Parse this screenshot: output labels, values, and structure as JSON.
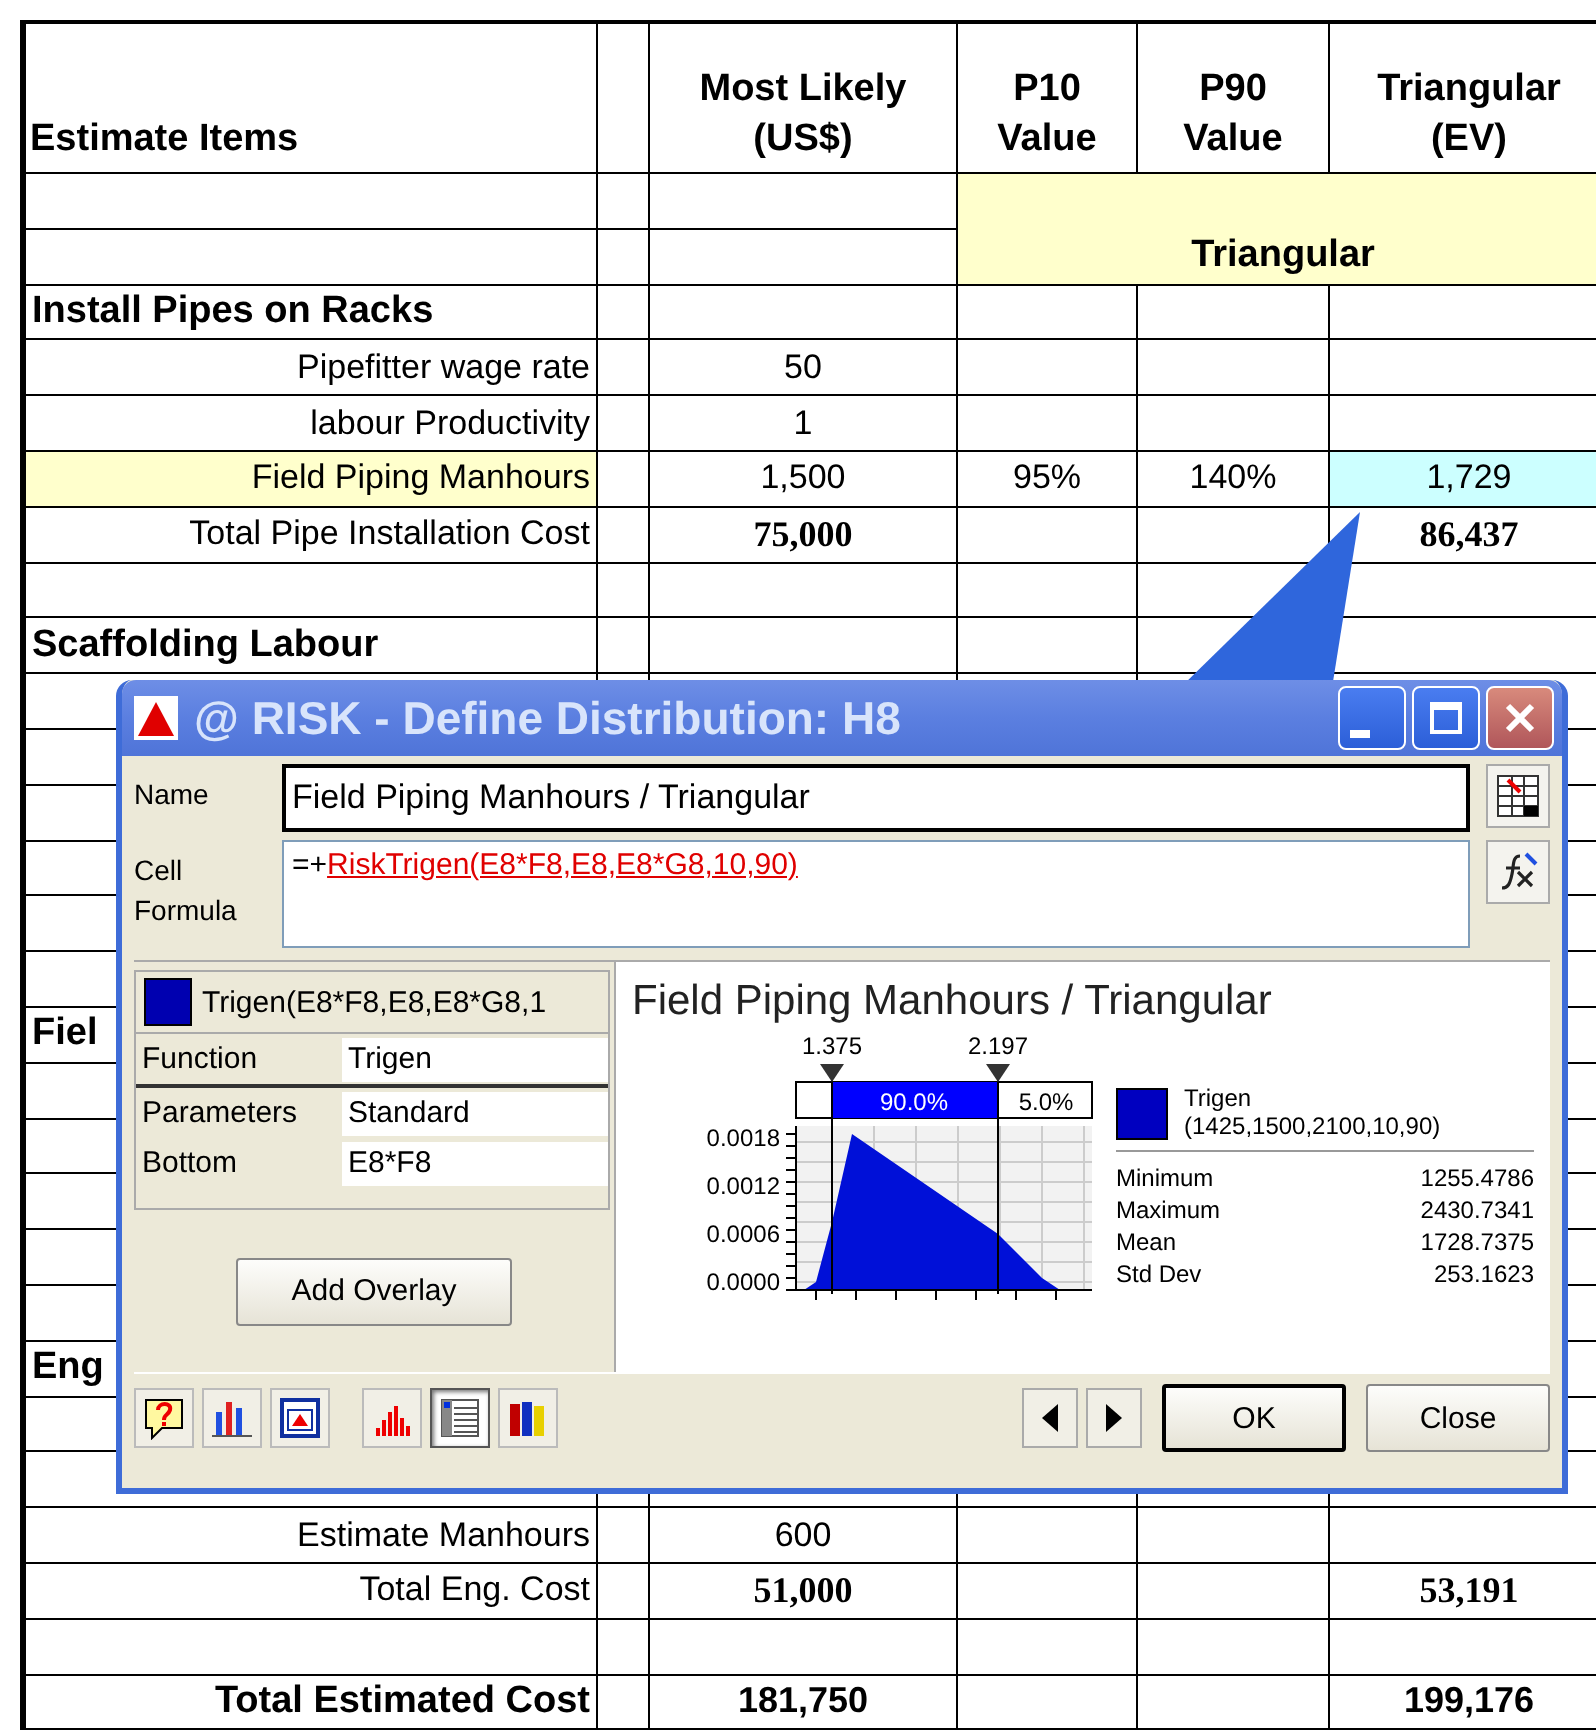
{
  "sheet": {
    "headers": [
      "Estimate Items",
      "Most Likely\n(US$)",
      "P10\nValue",
      "P90\nValue",
      "Triangular\n(EV)"
    ],
    "group_header": "Triangular",
    "rows": [
      {
        "kind": "blank",
        "active": false
      },
      {
        "kind": "blank",
        "active": false
      },
      {
        "kind": "section",
        "label": "Install Pipes on Racks",
        "active": false
      },
      {
        "kind": "item",
        "label": "Pipefitter wage rate",
        "most_likely": "50",
        "active": false
      },
      {
        "kind": "item",
        "label": "labour Productivity",
        "most_likely": "1",
        "active": false
      },
      {
        "kind": "item",
        "label": "Field Piping Manhours",
        "most_likely": "1,500",
        "p10": "95%",
        "p90": "140%",
        "triangular": "1,729",
        "active": true
      },
      {
        "kind": "total",
        "label": "Total Pipe Installation Cost",
        "most_likely": "75,000",
        "triangular": "86,437",
        "active": false
      },
      {
        "kind": "blank",
        "active": false
      },
      {
        "kind": "section",
        "label": "Scaffolding Labour",
        "active": false
      },
      {
        "kind": "blank",
        "active": false
      },
      {
        "kind": "blank",
        "active": false
      },
      {
        "kind": "blank",
        "active": false
      },
      {
        "kind": "blank",
        "active": false
      },
      {
        "kind": "blank",
        "active": false
      },
      {
        "kind": "blank",
        "active": false
      },
      {
        "kind": "section",
        "label": "Fiel",
        "active": false
      },
      {
        "kind": "blank",
        "active": false
      },
      {
        "kind": "blank",
        "active": false
      },
      {
        "kind": "blank",
        "active": false
      },
      {
        "kind": "blank",
        "active": false
      },
      {
        "kind": "blank",
        "active": false
      },
      {
        "kind": "section",
        "label": "Eng",
        "active": false
      },
      {
        "kind": "blank",
        "active": false
      },
      {
        "kind": "blank",
        "active": false
      },
      {
        "kind": "item",
        "label": "Estimate Manhours",
        "most_likely": "600",
        "active": false
      },
      {
        "kind": "total",
        "label": "Total Eng. Cost",
        "most_likely": "51,000",
        "triangular": "53,191",
        "active": false
      },
      {
        "kind": "blank",
        "active": false
      },
      {
        "kind": "grand",
        "label": "Total Estimated Cost",
        "most_likely": "181,750",
        "triangular": "199,176",
        "active": false
      }
    ]
  },
  "dialog": {
    "title": "@ RISK - Define Distribution: H8",
    "name_label": "Name",
    "name_value": "Field Piping Manhours / Triangular",
    "formula_label": "Cell\nFormula",
    "formula_prefix": "=+",
    "formula_link": "RiskTrigen(E8*F8,E8,E8*G8,10,90)",
    "distribution": "Trigen(E8*F8,E8,E8*G8,1",
    "properties": [
      {
        "name": "Function",
        "value": "Trigen"
      },
      {
        "name": "Parameters",
        "value": "Standard"
      },
      {
        "name": "Bottom",
        "value": "E8*F8"
      }
    ],
    "add_overlay": "Add Overlay",
    "chart": {
      "title": "Field Piping Manhours / Triangular",
      "markers": [
        "1.375",
        "2.197"
      ],
      "percentages": [
        "90.0%",
        "5.0%"
      ],
      "y_ticks": [
        "0.0018",
        "0.0012",
        "0.0006",
        "0.0000"
      ],
      "legend": "Trigen\n(1425,1500,2100,10,90)",
      "stats": [
        {
          "label": "Minimum",
          "value": "1255.4786"
        },
        {
          "label": "Maximum",
          "value": "2430.7341"
        },
        {
          "label": "Mean",
          "value": "1728.7375"
        },
        {
          "label": "Std Dev",
          "value": "253.1623"
        }
      ]
    },
    "toolbar": [
      {
        "kind": "help",
        "selected": false
      },
      {
        "kind": "bars",
        "selected": false
      },
      {
        "kind": "window",
        "selected": false
      },
      {
        "kind": "histogram",
        "selected": false
      },
      {
        "kind": "list",
        "selected": true
      },
      {
        "kind": "books",
        "selected": false
      }
    ],
    "buttons": [
      {
        "label": "OK",
        "default": true
      },
      {
        "label": "Close",
        "default": false
      }
    ]
  }
}
